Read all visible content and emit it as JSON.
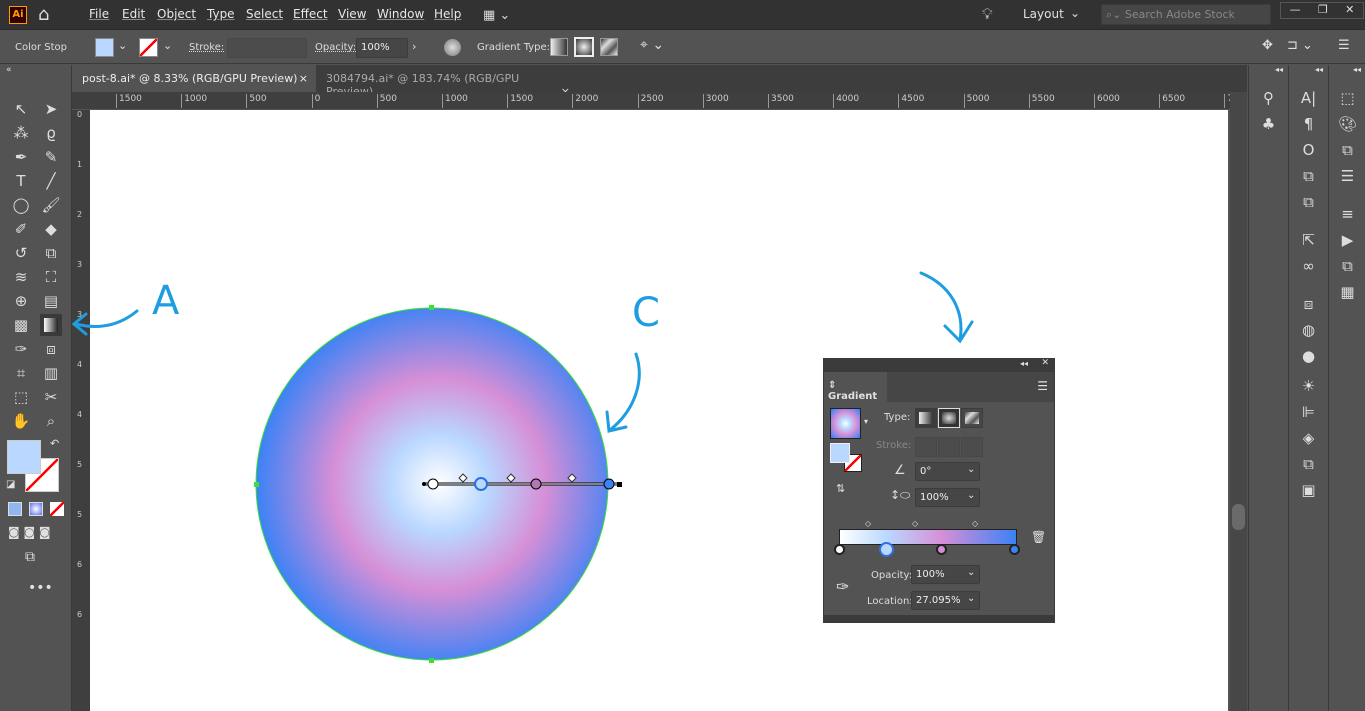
{
  "app": {
    "logo": "Ai",
    "menu": [
      "File",
      "Edit",
      "Object",
      "Type",
      "Select",
      "Effect",
      "View",
      "Window",
      "Help"
    ],
    "workspace": "Layout",
    "search_placeholder": "Search Adobe Stock"
  },
  "control_bar": {
    "mode": "Color Stop",
    "stroke_label": "Stroke:",
    "opacity_label": "Opacity:",
    "opacity_value": "100%",
    "gradient_type_label": "Gradient Type:",
    "fill_color": "#b9d7ff"
  },
  "tabs": [
    {
      "label": "post-8.ai* @ 8.33% (RGB/GPU Preview)",
      "active": true
    },
    {
      "label": "3084794.ai* @ 183.74% (RGB/GPU Preview)",
      "active": false
    }
  ],
  "ruler": [
    "1500",
    "1000",
    "500",
    "0",
    "500",
    "1000",
    "1500",
    "2000",
    "2500",
    "3000",
    "3500",
    "4000",
    "4500",
    "5000",
    "5500",
    "6000",
    "6500",
    "70"
  ],
  "vruler": [
    "0",
    "1",
    "2",
    "3",
    "3",
    "4",
    "4",
    "5",
    "5",
    "6",
    "6"
  ],
  "gradient_panel": {
    "title": "Gradient",
    "type_label": "Type:",
    "stroke_label": "Stroke:",
    "angle": "0°",
    "aspect": "100%",
    "opacity_label": "Opacity:",
    "opacity_value": "100%",
    "location_label": "Location:",
    "location_value": "27.095%",
    "stops": [
      {
        "color": "#ffffff",
        "location": 0
      },
      {
        "color": "#b9d7ff",
        "location": 27.095,
        "selected": true
      },
      {
        "color": "#d68fd6",
        "location": 58
      },
      {
        "color": "#3b82f6",
        "location": 100
      }
    ]
  },
  "annotations": {
    "a": "A",
    "c": "C"
  },
  "colors": {
    "accent": "#1e9de0",
    "selection": "#39e039"
  }
}
